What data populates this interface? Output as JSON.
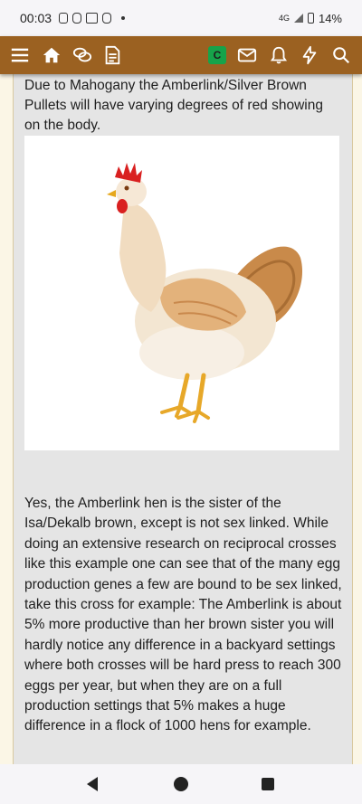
{
  "status_bar": {
    "time": "00:03",
    "network": "4G",
    "battery": "14%",
    "notification_icons": [
      "sim-alert-icon",
      "instagram-icon",
      "gmail-icon",
      "instagram-icon",
      "dot-icon"
    ]
  },
  "toolbar": {
    "icons": [
      "menu-icon",
      "home-icon",
      "chat-icon",
      "document-icon",
      "conversation-icon",
      "mail-icon",
      "bell-icon",
      "bolt-icon",
      "search-icon"
    ],
    "badge_label": "C",
    "background_color": "#9b6121",
    "badge_color": "#16a34a"
  },
  "post": {
    "paragraph_1": "Due to Mahogany the Amberlink/Silver Brown Pullets will have varying degrees of red showing on the body.",
    "image": "white-hen-illustration",
    "paragraph_2": "Yes, the Amberlink hen is the sister of the Isa/Dekalb brown, except is not sex linked. While doing an extensive research on reciprocal crosses like this example one can see that of the many egg production genes a few are bound to be sex linked, take this cross for example: The Amberlink is about 5% more productive than her brown sister you will hardly notice any difference in a backyard settings where both crosses will be hard press to reach 300 eggs per year, but when they are on a full production settings that 5% makes a huge difference in a flock of 1000 hens for example."
  },
  "system_nav": {
    "icons": [
      "back-icon",
      "home-circle-icon",
      "recents-icon"
    ]
  }
}
